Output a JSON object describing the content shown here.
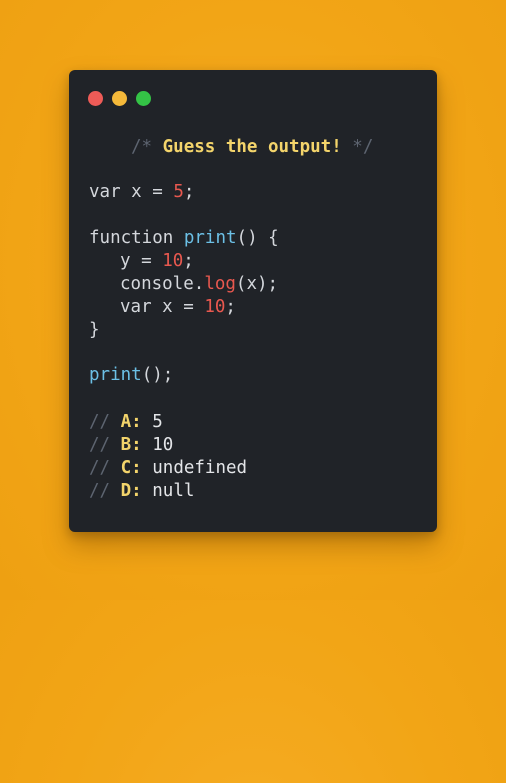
{
  "colors": {
    "background": "#f2a516",
    "card": "#202328",
    "dot_red": "#ee5b57",
    "dot_yellow": "#f5b93a",
    "dot_green": "#34c346",
    "comment": "#5d6470",
    "title": "#f3d46b",
    "number": "#e8584f",
    "function": "#6cc0e6"
  },
  "window": {
    "buttons": [
      "red",
      "yellow",
      "green"
    ]
  },
  "code": {
    "title_open": "/*",
    "title_text": "Guess the output!",
    "title_close": "*/",
    "line1": {
      "kw": "var",
      "name": "x",
      "eq": "=",
      "num": "5",
      "end": ";"
    },
    "line2": {
      "kw": "function",
      "fn": "print",
      "parens": "()",
      "brace": "{"
    },
    "line3": {
      "name": "y",
      "eq": "=",
      "num": "10",
      "end": ";"
    },
    "line4": {
      "obj": "console",
      "dot": ".",
      "method": "log",
      "args": "(x);"
    },
    "line5": {
      "kw": "var",
      "name": "x",
      "eq": "=",
      "num": "10",
      "end": ";"
    },
    "line6": {
      "brace": "}"
    },
    "line7": {
      "fn": "print",
      "call": "();"
    }
  },
  "options": [
    {
      "prefix": "//",
      "label": "A:",
      "value": "5"
    },
    {
      "prefix": "//",
      "label": "B:",
      "value": "10"
    },
    {
      "prefix": "//",
      "label": "C:",
      "value": "undefined"
    },
    {
      "prefix": "//",
      "label": "D:",
      "value": "null"
    }
  ]
}
